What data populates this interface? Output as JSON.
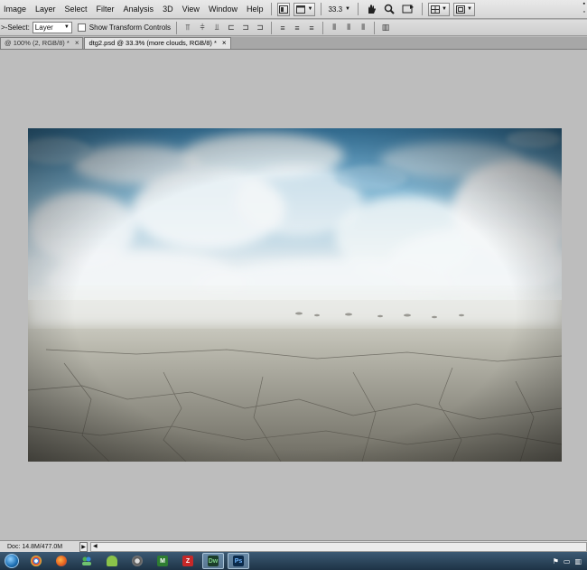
{
  "menu": [
    "Image",
    "Layer",
    "Select",
    "Filter",
    "Analysis",
    "3D",
    "View",
    "Window",
    "Help"
  ],
  "menubar": {
    "zoom": "33.3",
    "zoom_arrow": "▼"
  },
  "options": {
    "auto_select_label": ">-Select:",
    "auto_select_value": "Layer",
    "show_transform_label": "Show Transform Controls"
  },
  "tabs": [
    {
      "label": "@ 100% (2, RGB/8) *",
      "active": false
    },
    {
      "label": "dtg2.psd @ 33.3% (more clouds, RGB/8) *",
      "active": true
    }
  ],
  "status": {
    "doc": "Doc: 14.8M/477.0M"
  },
  "icons": {
    "close": "×",
    "dropdown": "▼",
    "play": "▶",
    "left": "◀"
  },
  "colors": {
    "canvas_bg": "#bdbdbd",
    "taskbar": "#2a4660"
  }
}
